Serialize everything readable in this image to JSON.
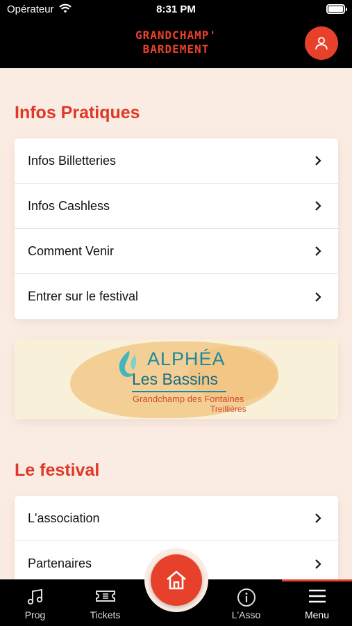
{
  "status_bar": {
    "carrier": "Opérateur",
    "time": "8:31 PM"
  },
  "header": {
    "logo_line1": "GRANDCHAMP'",
    "logo_line2": "BARDEMENT"
  },
  "sections": [
    {
      "title": "Infos Pratiques",
      "items": [
        {
          "label": "Infos Billetteries"
        },
        {
          "label": "Infos Cashless"
        },
        {
          "label": "Comment Venir"
        },
        {
          "label": "Entrer sur le festival"
        }
      ]
    },
    {
      "title": "Le festival",
      "items": [
        {
          "label": "L'association"
        },
        {
          "label": "Partenaires"
        }
      ]
    }
  ],
  "sponsor_banner": {
    "brand": "ALPHÉA",
    "name": "Les Bassins",
    "location_line1": "Grandchamp des Fontaines",
    "location_line2": "Treillières"
  },
  "tabbar": {
    "tabs": [
      {
        "label": "Prog",
        "icon": "music-note-icon"
      },
      {
        "label": "Tickets",
        "icon": "ticket-icon"
      },
      {
        "label": "L'Asso",
        "icon": "info-icon"
      },
      {
        "label": "Menu",
        "icon": "menu-icon",
        "active": true
      }
    ],
    "home_icon": "home-icon"
  },
  "colors": {
    "accent": "#e8412b",
    "background": "#fbece3",
    "header": "#000000"
  }
}
